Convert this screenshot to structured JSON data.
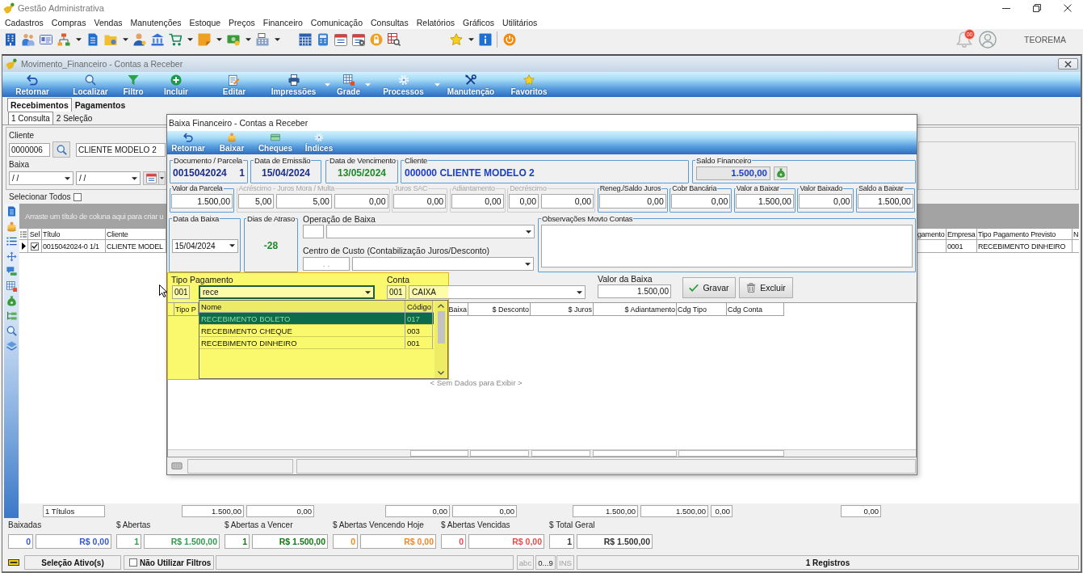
{
  "app": {
    "title": "Gestão Administrativa",
    "notifications": "00",
    "user": "TEOREMA"
  },
  "menu": [
    "Cadastros",
    "Compras",
    "Vendas",
    "Manutenções",
    "Estoque",
    "Preços",
    "Financeiro",
    "Comunicação",
    "Consultas",
    "Relatórios",
    "Gráficos",
    "Utilitários"
  ],
  "window": {
    "title": "Movimento_Financeiro - Contas a Receber",
    "toolbar": [
      {
        "label": "Retornar",
        "dropdown": false
      },
      {
        "label": "Localizar",
        "dropdown": false
      },
      {
        "label": "Filtro",
        "dropdown": false
      },
      {
        "label": "Incluir",
        "dropdown": false
      },
      {
        "label": "Editar",
        "dropdown": false
      },
      {
        "label": "Impressões",
        "dropdown": true
      },
      {
        "label": "Grade",
        "dropdown": true
      },
      {
        "label": "Processos",
        "dropdown": true
      },
      {
        "label": "Manutenção",
        "dropdown": false
      },
      {
        "label": "Favoritos",
        "dropdown": false
      }
    ],
    "tabs": [
      {
        "label": "Recebimentos",
        "selected": true
      },
      {
        "label": "Pagamentos",
        "selected": false
      }
    ],
    "subtabs": [
      {
        "label": "1 Consulta",
        "selected": true
      },
      {
        "label": "2 Seleção",
        "selected": false
      }
    ],
    "filters": {
      "cliente_label": "Cliente",
      "cliente_code": "0000006",
      "cliente_name": "CLIENTE MODELO 2",
      "baixa_label": "Baixa",
      "baixa_from": "/ /",
      "baixa_to": "/ /"
    },
    "select_all": {
      "label": "Selecionar Todos",
      "checked": false
    },
    "grid": {
      "group_hint": "Arraste um título de coluna aqui para criar u",
      "columns": [
        "Sel",
        "Título",
        "Cliente",
        "gamento",
        "Empresa",
        "Tipo Pagamento Previsto",
        "N"
      ],
      "rows": [
        {
          "current": true,
          "checked": true,
          "titulo": "0015042024-0 1/1",
          "cliente": "CLIENTE MODEL",
          "empresa": "0001",
          "tipo_pagamento_previsto": "RECEBIMENTO DINHEIRO"
        }
      ],
      "totals": [
        "1 Títulos",
        "1.500,00",
        "0,00",
        "0,00",
        "0,00",
        "1.500,00",
        "1.500,00",
        "0,00",
        "0,00"
      ]
    },
    "summary": [
      {
        "label": "Baixadas",
        "count": "0",
        "amount": "R$ 0,00",
        "color": "#3558e0"
      },
      {
        "label": "$ Abertas",
        "count": "1",
        "amount": "R$ 1.500,00",
        "color": "#2e9e4e"
      },
      {
        "label": "$ Abertas a Vencer",
        "count": "1",
        "amount": "R$ 1.500,00",
        "color": "#127812"
      },
      {
        "label": "$ Abertas Vencendo Hoje",
        "count": "0",
        "amount": "R$ 0,00",
        "color": "#f08a24"
      },
      {
        "label": "$ Abertas Vencidas",
        "count": "0",
        "amount": "R$ 0,00",
        "color": "#f04a4a"
      },
      {
        "label": "$ Total Geral",
        "count": "1",
        "amount": "R$ 1.500,00",
        "color": "#333333"
      }
    ],
    "status_bar": {
      "selection": "Seleção Ativo(s)",
      "no_filters": {
        "label": "Não Utilizar Filtros",
        "checked": false
      },
      "indicators": [
        {
          "label": "abc",
          "on": false
        },
        {
          "label": "0...9",
          "on": true
        },
        {
          "label": "INS",
          "on": false
        }
      ],
      "records": "1 Registros"
    }
  },
  "dialog": {
    "title": "Baixa Financeiro - Contas a Receber",
    "toolbar": [
      "Retornar",
      "Baixar",
      "Cheques",
      "Índices"
    ],
    "documento": {
      "label": "Documento / Parcela",
      "numero": "0015042024",
      "parcela": "1"
    },
    "emissao": {
      "label": "Data de Emissão",
      "value": "15/04/2024"
    },
    "vencimento": {
      "label": "Data de Vencimento",
      "value": "13/05/2024"
    },
    "cliente": {
      "label": "Cliente",
      "value": "000000 CLIENTE MODELO 2"
    },
    "saldo_financeiro": {
      "label": "Saldo Financeiro",
      "value": "1.500,00"
    },
    "amounts": [
      {
        "label": "Valor da Parcela",
        "disabled": false,
        "values": [
          "1.500,00"
        ]
      },
      {
        "label": "Acréscimo - Juros Mora / Multa",
        "disabled": true,
        "values": [
          "5,00",
          "5,00",
          "0,00"
        ]
      },
      {
        "label": "Juros SAC",
        "disabled": true,
        "values": [
          "0,00"
        ]
      },
      {
        "label": "Adiantamento",
        "disabled": true,
        "values": [
          "0,00"
        ]
      },
      {
        "label": "Decréscimo",
        "disabled": true,
        "values": [
          "0,00",
          "0,00"
        ]
      },
      {
        "label": "Reneg./Saldo Juros",
        "disabled": false,
        "values": [
          "0,00"
        ]
      },
      {
        "label": "Cobr Bancária",
        "disabled": false,
        "values": [
          "0,00"
        ]
      },
      {
        "label": "Valor a Baixar",
        "disabled": false,
        "values": [
          "1.500,00"
        ]
      },
      {
        "label": "Valor Baixado",
        "disabled": false,
        "values": [
          "0,00"
        ]
      },
      {
        "label": "Saldo a Baixar",
        "disabled": false,
        "values": [
          "1.500,00"
        ]
      }
    ],
    "data_baixa": {
      "label": "Data da Baixa",
      "value": "15/04/2024"
    },
    "dias_atraso": {
      "label": "Dias de Atraso",
      "value": "-28"
    },
    "operacao_baixa": {
      "label": "Operação de Baixa"
    },
    "centro_custo": {
      "label": "Centro de Custo (Contabilização Juros/Desconto)",
      "placeholder": ". ."
    },
    "observacoes": {
      "label": "Observações Movto Contas"
    },
    "tipo_pagamento": {
      "label": "Tipo Pagamento",
      "code": "001",
      "value": "rece",
      "focused": true,
      "highlighted": true,
      "list": {
        "columns": [
          "Nome",
          "Código"
        ],
        "options": [
          {
            "name": "RECEBIMENTO BOLETO",
            "code": "017",
            "selected": true
          },
          {
            "name": "RECEBIMENTO CHEQUE",
            "code": "003",
            "selected": false
          },
          {
            "name": "RECEBIMENTO DINHEIRO",
            "code": "001",
            "selected": false
          }
        ]
      }
    },
    "conta": {
      "label": "Conta",
      "code": "001",
      "name": "CAIXA"
    },
    "valor_baixa": {
      "label": "Valor da Baixa",
      "value": "1.500,00"
    },
    "buttons": [
      {
        "label": "Gravar",
        "kind": "save"
      },
      {
        "label": "Excluir",
        "kind": "delete"
      }
    ],
    "grid": {
      "columns": [
        "Tipo P",
        "Baixa",
        "$ Desconto",
        "$ Juros",
        "$ Adiantamento",
        "Cdg Tipo",
        "Cdg Conta"
      ],
      "empty_text": "< Sem Dados para Exibir >"
    }
  }
}
